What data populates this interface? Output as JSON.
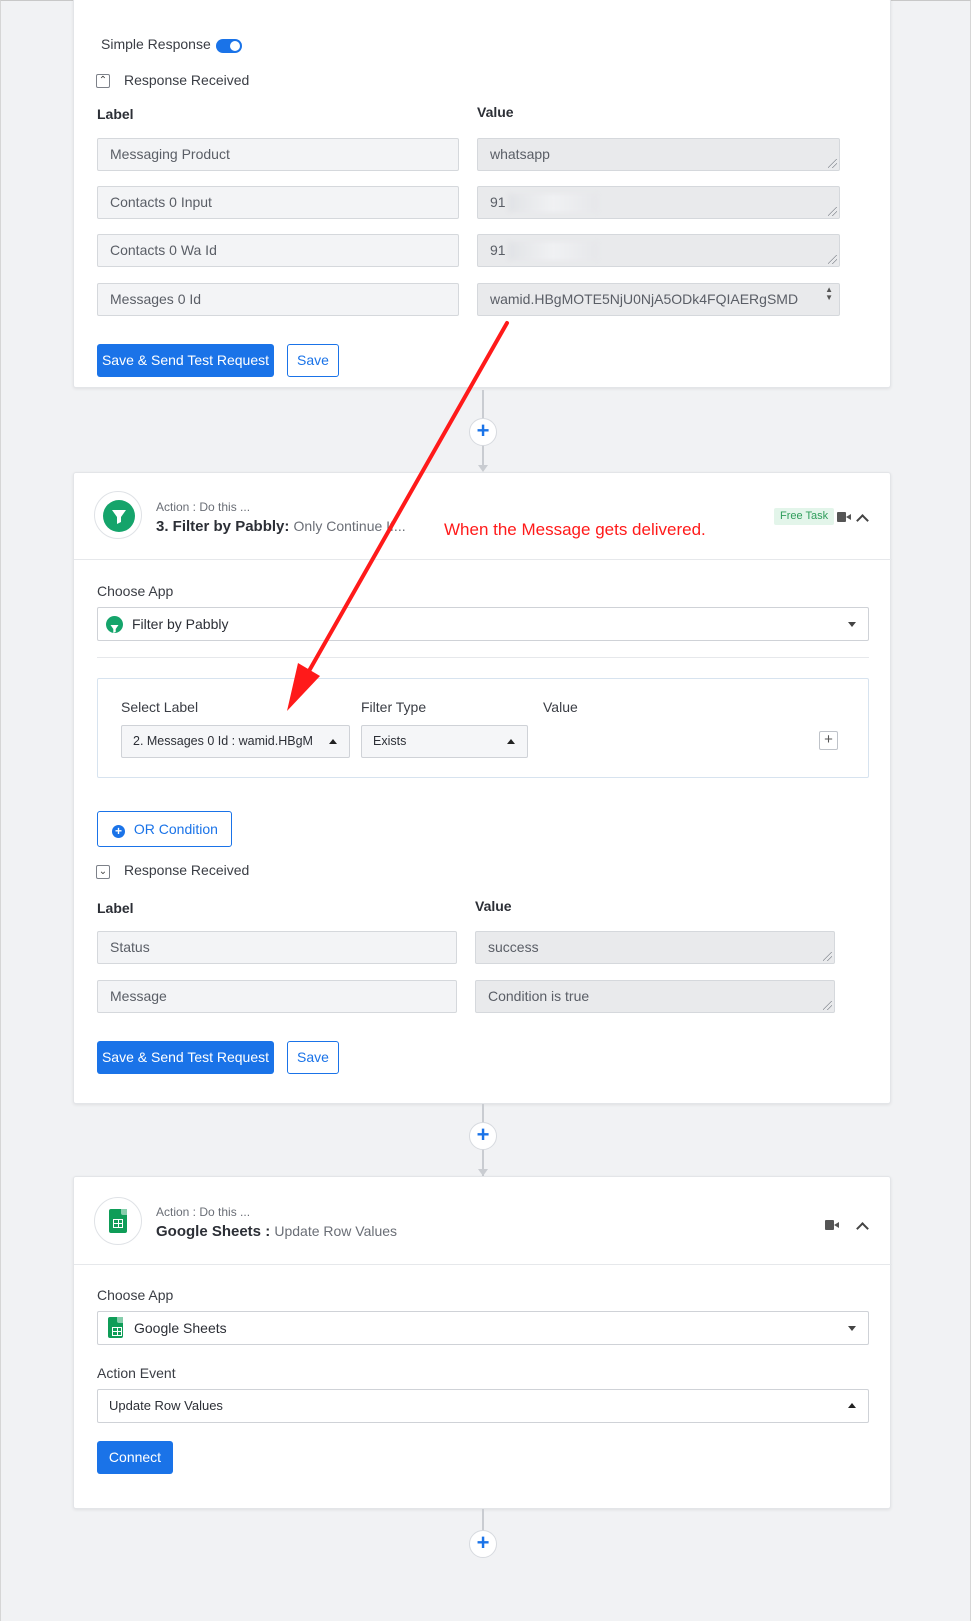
{
  "step2": {
    "simple_response_label": "Simple Response",
    "response_received_label": "Response Received",
    "label_header": "Label",
    "value_header": "Value",
    "rows": [
      {
        "label": "Messaging Product",
        "value": "whatsapp"
      },
      {
        "label": "Contacts 0 Input",
        "value": "91"
      },
      {
        "label": "Contacts 0 Wa Id",
        "value": "91"
      },
      {
        "label": "Messages 0 Id",
        "value": "wamid.HBgMOTE5NjU0NjA5ODk4FQIAERgSMD"
      }
    ],
    "save_send_label": "Save & Send Test Request",
    "save_label": "Save"
  },
  "step3": {
    "action_prefix": "Action : Do this ...",
    "title_bold": "3. Filter by Pabbly:",
    "title_rest": "Only Continue If...",
    "badge": "Free Task",
    "choose_app_label": "Choose App",
    "app_name": "Filter by Pabbly",
    "filter": {
      "select_label_header": "Select Label",
      "filter_type_header": "Filter Type",
      "value_header": "Value",
      "select_label_value": "2. Messages 0 Id : wamid.HBgM",
      "filter_type_value": "Exists"
    },
    "or_condition_label": "OR Condition",
    "response_received_label": "Response Received",
    "label_header": "Label",
    "value_header": "Value",
    "rows": [
      {
        "label": "Status",
        "value": "success"
      },
      {
        "label": "Message",
        "value": "Condition is true"
      }
    ],
    "save_send_label": "Save & Send Test Request",
    "save_label": "Save"
  },
  "step4": {
    "action_prefix": "Action : Do this ...",
    "title_bold": "Google Sheets :",
    "title_rest": "Update Row Values",
    "choose_app_label": "Choose App",
    "app_name": "Google Sheets",
    "action_event_label": "Action Event",
    "action_event_value": "Update Row Values",
    "connect_label": "Connect"
  },
  "annotation": {
    "text": "When the Message gets delivered.",
    "color": "#ff1a1a"
  },
  "colors": {
    "accent": "#1a73e8",
    "filter_green": "#15a46b",
    "sheets_green": "#0f9d58"
  },
  "icons": [
    "plus-icon",
    "filter-icon",
    "google-sheets-icon",
    "video-icon",
    "chevron-up-icon",
    "chevron-down-icon",
    "plus-circle-icon"
  ]
}
